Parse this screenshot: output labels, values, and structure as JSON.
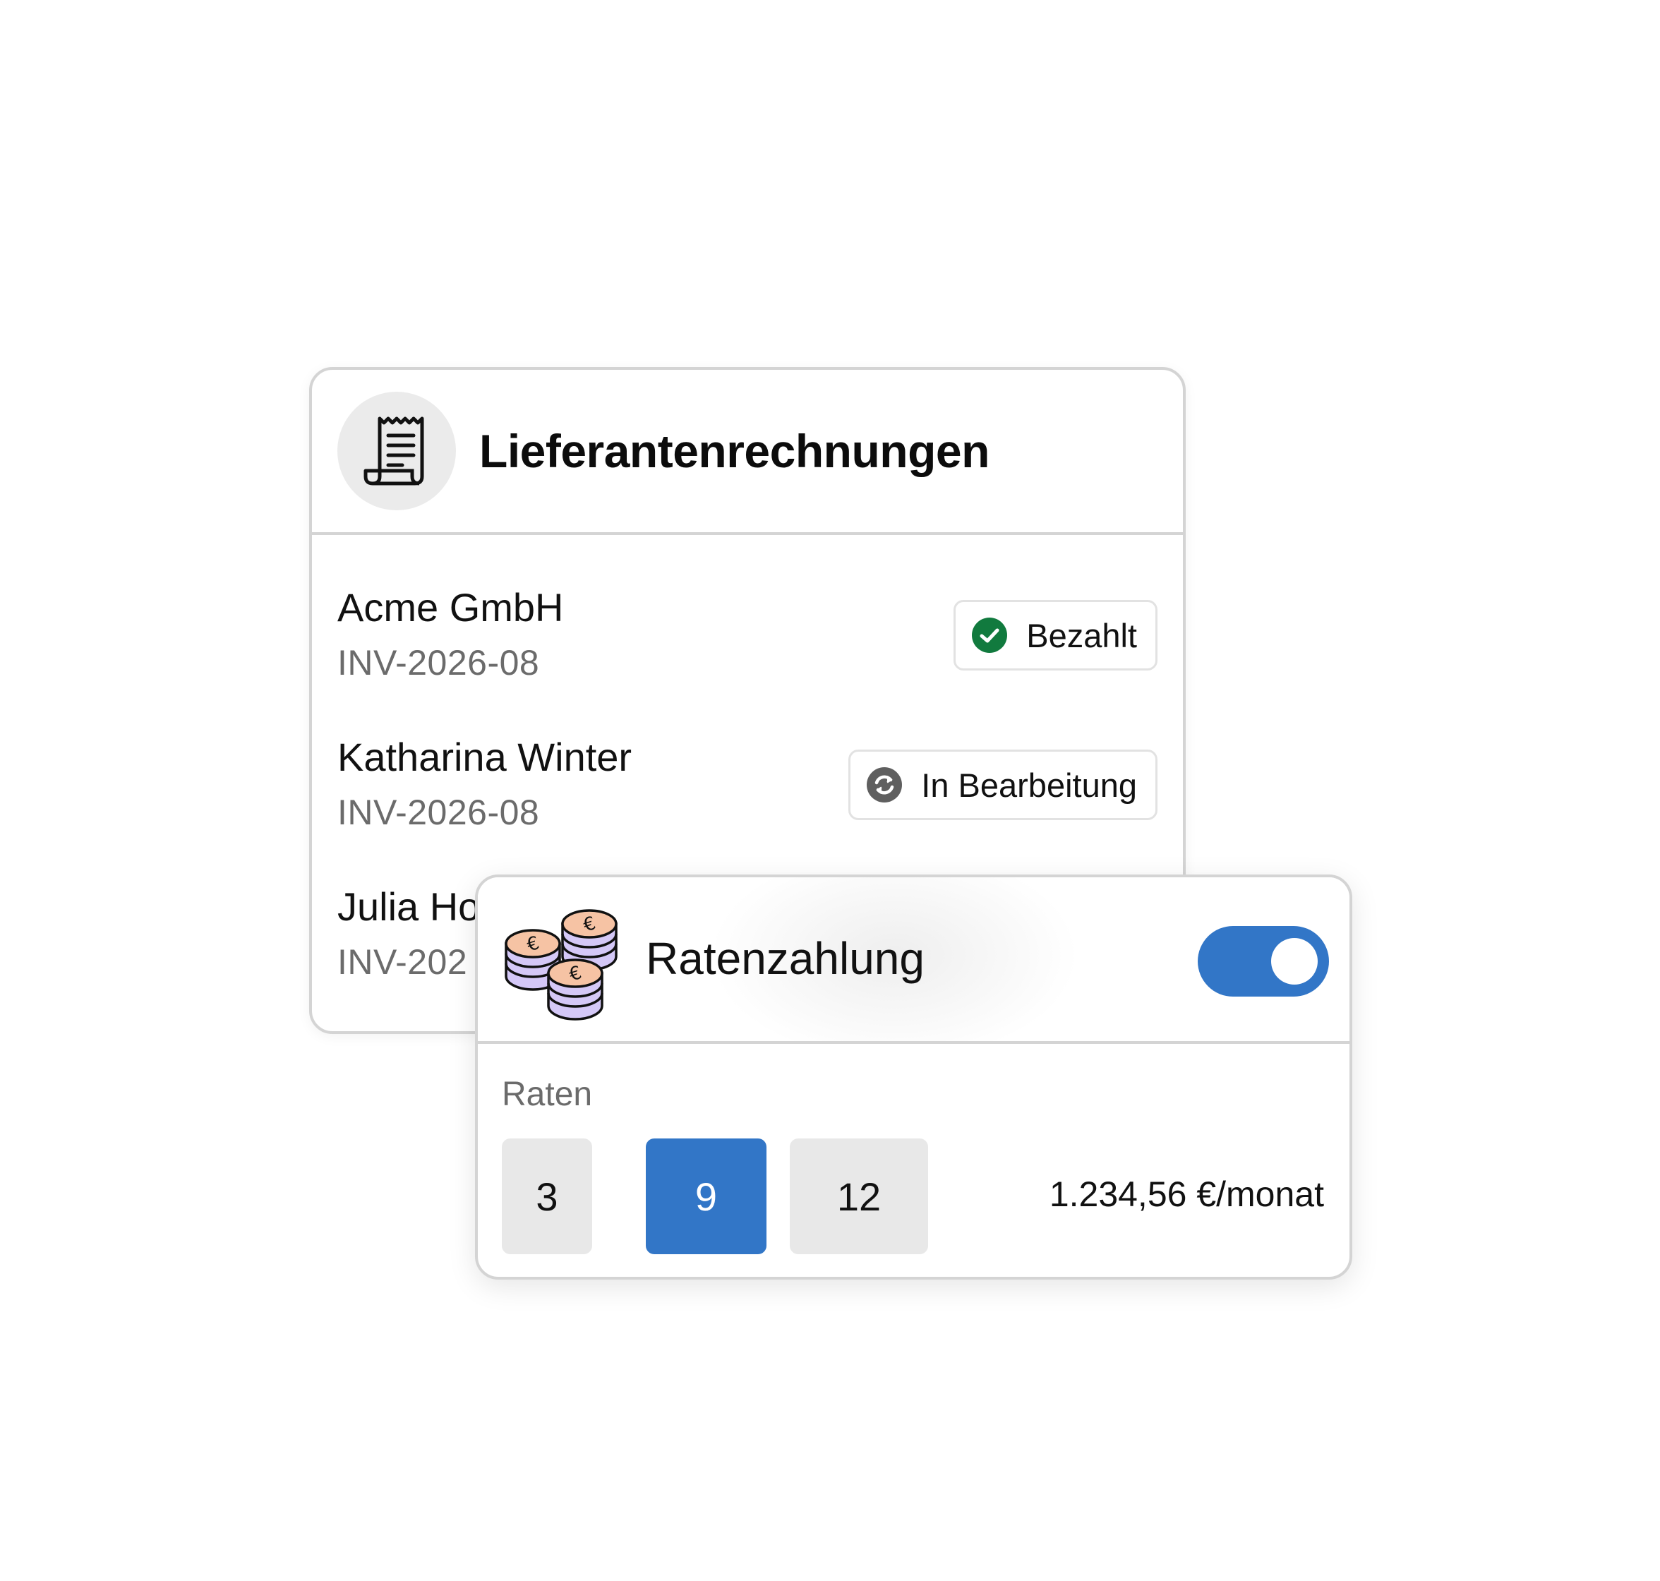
{
  "invoices": {
    "title": "Lieferantenrechnungen",
    "icon": "receipt-icon",
    "items": [
      {
        "name": "Acme GmbH",
        "number": "INV-2026-08",
        "status": "Bezahlt",
        "status_icon": "check-circle-icon",
        "status_color": "#117a3e"
      },
      {
        "name": "Katharina Winter",
        "number": "INV-2026-08",
        "status": "In Bearbeitung",
        "status_icon": "refresh-circle-icon",
        "status_color": "#5f5f5f"
      },
      {
        "name": "Julia Ho",
        "number": "INV-202"
      }
    ]
  },
  "installment": {
    "title": "Ratenzahlung",
    "icon": "euro-coins-icon",
    "enabled": true,
    "rates_label": "Raten",
    "options": [
      "3",
      "9",
      "12"
    ],
    "selected_option": "9",
    "monthly_amount": "1.234,56 €/monat"
  },
  "colors": {
    "accent": "#3276c7",
    "success": "#117a3e",
    "border": "#d4d4d4",
    "muted_text": "#6b6b6b",
    "icon_circle": "#ebebeb"
  }
}
